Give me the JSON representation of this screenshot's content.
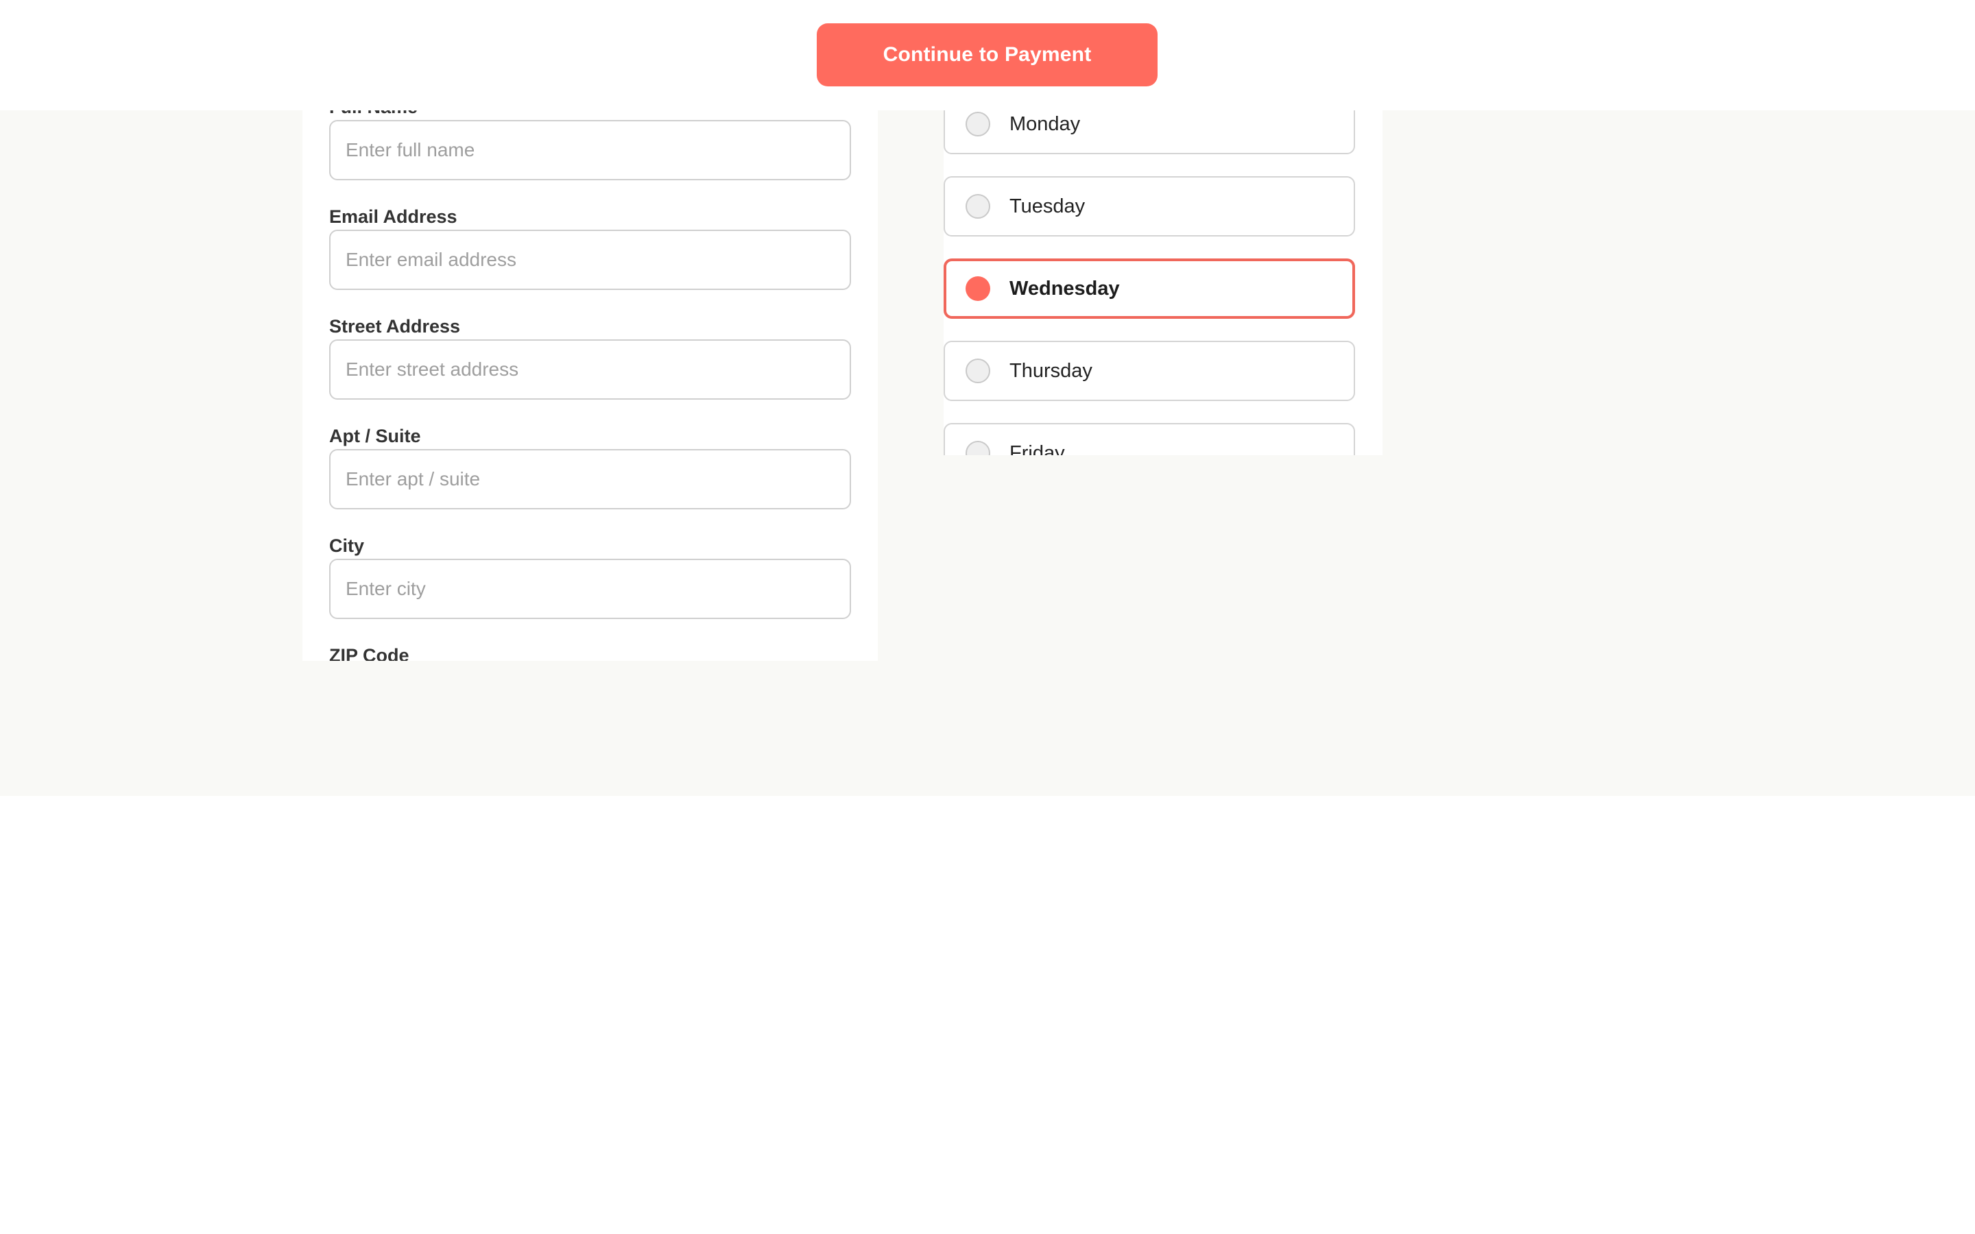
{
  "header": {
    "continue_label": "Continue to Payment"
  },
  "form": {
    "fields": [
      {
        "label": "Full Name",
        "placeholder": "Enter full name",
        "value": ""
      },
      {
        "label": "Email Address",
        "placeholder": "Enter email address",
        "value": ""
      },
      {
        "label": "Street Address",
        "placeholder": "Enter street address",
        "value": ""
      },
      {
        "label": "Apt / Suite",
        "placeholder": "Enter apt / suite",
        "value": ""
      },
      {
        "label": "City",
        "placeholder": "Enter city",
        "value": ""
      },
      {
        "label": "ZIP Code",
        "placeholder": "",
        "value": ""
      }
    ]
  },
  "delivery_days": {
    "selected": "Wednesday",
    "options": [
      {
        "label": "Monday"
      },
      {
        "label": "Tuesday"
      },
      {
        "label": "Wednesday"
      },
      {
        "label": "Thursday"
      },
      {
        "label": "Friday"
      }
    ]
  },
  "colors": {
    "accent": "#ff6b5e",
    "selected_border": "#f0675b",
    "page_background": "#f9f9f6",
    "input_border": "#cfcfcf"
  }
}
